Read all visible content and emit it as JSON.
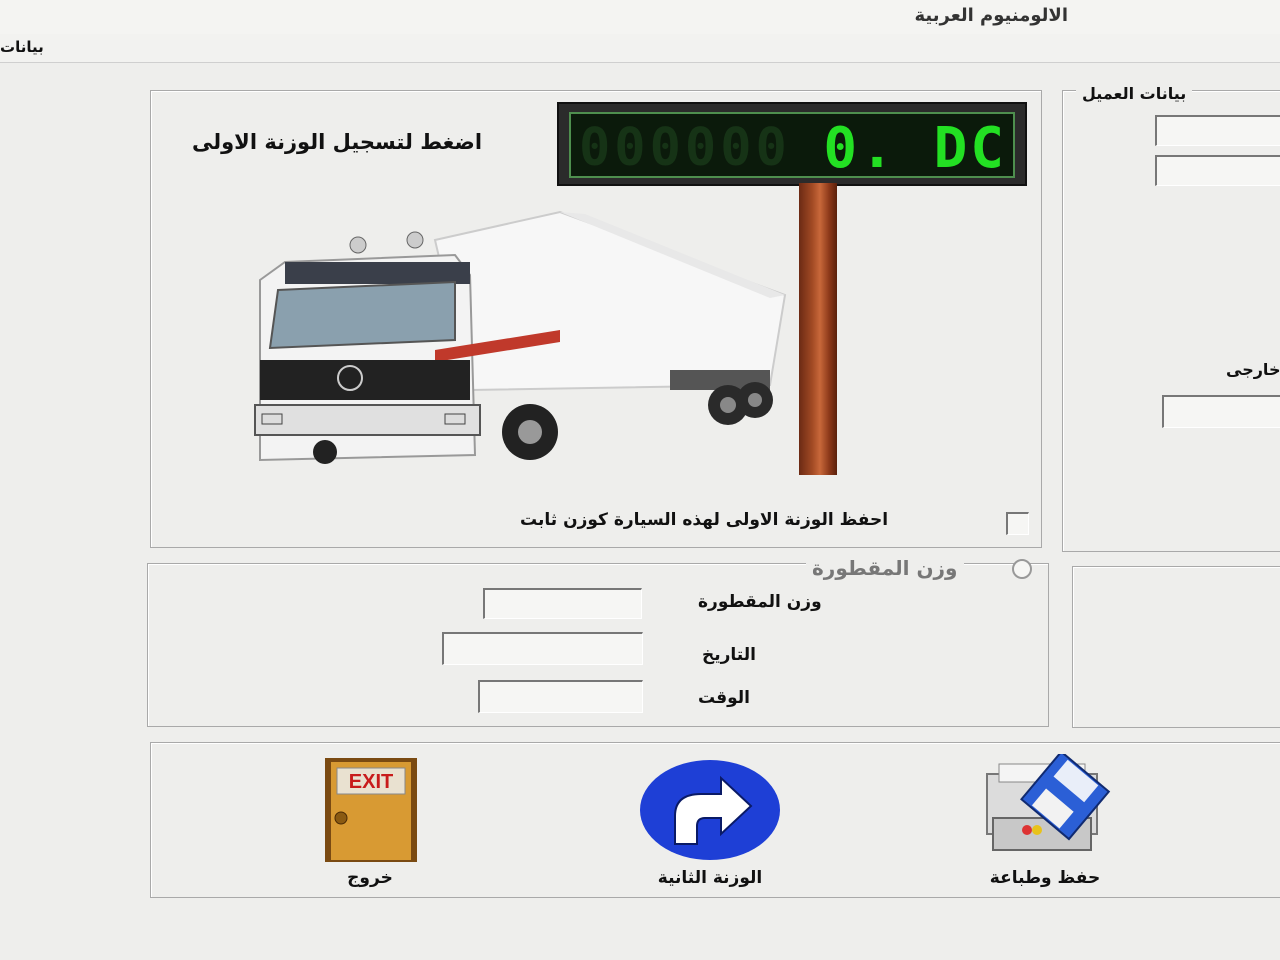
{
  "window": {
    "title": "الالومنيوم العربية"
  },
  "menu": {
    "item": "بيانات"
  },
  "weighing": {
    "prompt": "اضغط لتسجيل الوزنة الاولى",
    "display_value": "0. DC",
    "display_ghost": "000000",
    "save_first_weight_label": "احفظ الوزنة الاولى لهذه السيارة كوزن ثابت",
    "save_first_weight_checked": false
  },
  "customer": {
    "group_title": "بيانات العميل",
    "external_label": "خارجى"
  },
  "scrap": {
    "group_title": "وزن المقطورة",
    "weight_label": "وزن المقطورة",
    "date_label": "التاريخ",
    "time_label": "الوقت",
    "weight_value": "",
    "date_value": "",
    "time_value": ""
  },
  "buttons": {
    "exit_label": "خروج",
    "exit_sign": "EXIT",
    "second_weight_label": "الوزنة الثانية",
    "save_print_label": "حفظ وطباعة"
  }
}
